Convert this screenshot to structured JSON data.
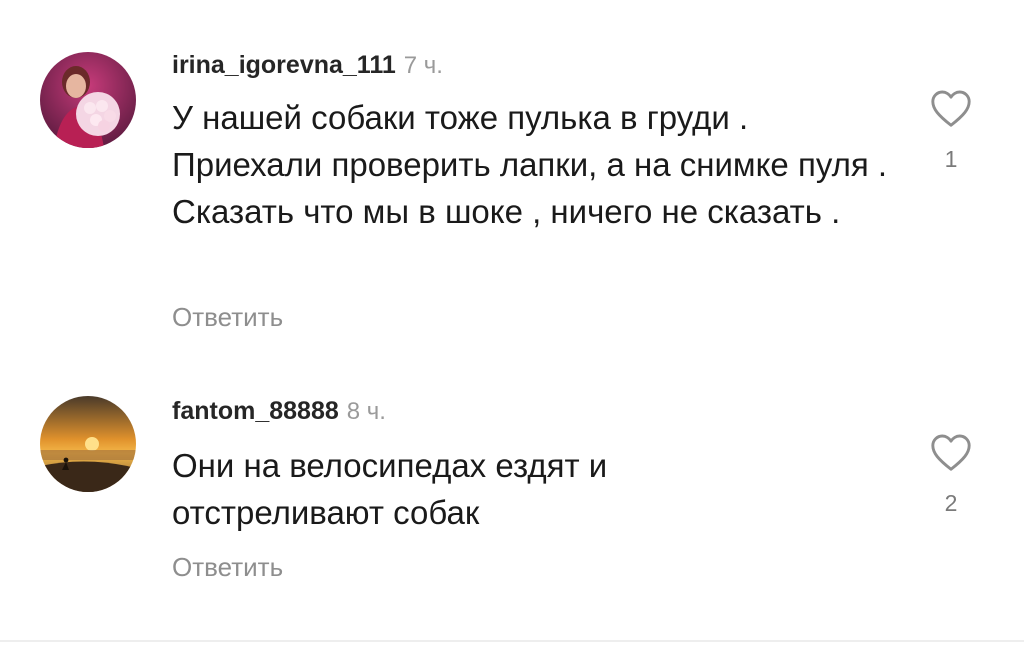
{
  "comments": [
    {
      "username": "irina_igorevna_111",
      "time": "7 ч.",
      "text": "У нашей собаки тоже пулька в груди . Приехали проверить лапки, а на снимке пуля . Сказать что мы в шоке , ничего не сказать .",
      "reply_label": "Ответить",
      "likes": "1",
      "avatar_icon": "woman-with-flowers-avatar"
    },
    {
      "username": "fantom_88888",
      "time": "8 ч.",
      "text": "Они на велосипедах ездят и отстреливают собак",
      "reply_label": "Ответить",
      "likes": "2",
      "avatar_icon": "sunset-beach-avatar"
    }
  ],
  "icons": {
    "like": "heart-icon"
  },
  "colors": {
    "username": "#262626",
    "meta": "#9a9a9a",
    "reply": "#8e8e8e",
    "heart": "#8e8e8e"
  }
}
